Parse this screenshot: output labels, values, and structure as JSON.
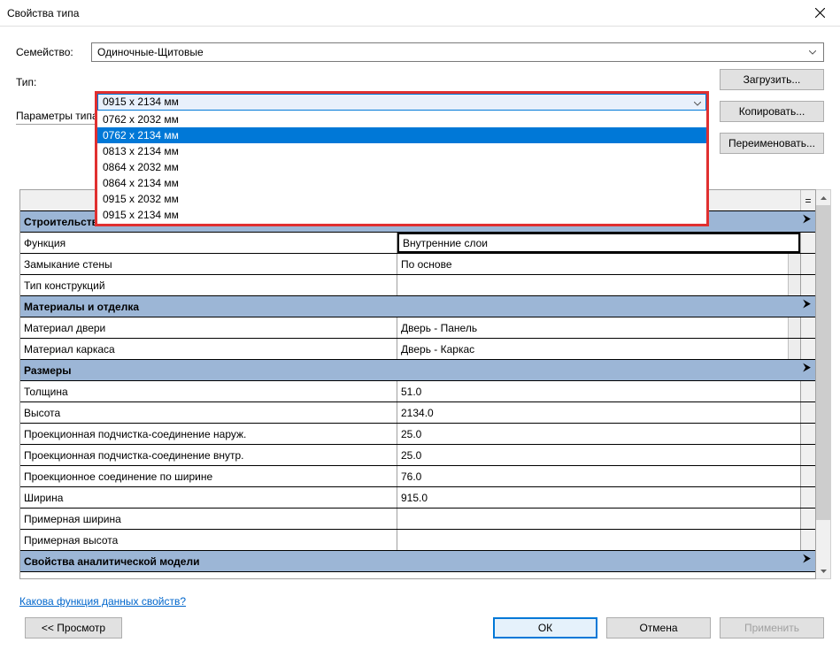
{
  "window": {
    "title": "Свойства типа"
  },
  "labels": {
    "family": "Семейство:",
    "type": "Тип:",
    "params": "Параметры типа"
  },
  "family_select": {
    "value": "Одиночные-Щитовые"
  },
  "type_select": {
    "value": "0915 x 2134 мм"
  },
  "side_buttons": {
    "load": "Загрузить...",
    "copy": "Копировать...",
    "rename": "Переименовать..."
  },
  "dropdown": {
    "items": [
      "0762 x 2032 мм",
      "0762 x 2134 мм",
      "0813 x 2134 мм",
      "0864 x 2032 мм",
      "0864 x 2134 мм",
      "0915 x 2032 мм",
      "0915 x 2134 мм"
    ],
    "highlighted_index": 1
  },
  "eq_header": "=",
  "groups": [
    {
      "name": "Строительство",
      "rows": [
        {
          "label": "Функция",
          "value": "Внутренние слои",
          "bordered": true
        },
        {
          "label": "Замыкание стены",
          "value": "По основе",
          "mini": true
        },
        {
          "label": "Тип конструкций",
          "value": "",
          "mini": true
        }
      ]
    },
    {
      "name": "Материалы и отделка",
      "rows": [
        {
          "label": "Материал двери",
          "value": "Дверь - Панель",
          "mini": true
        },
        {
          "label": "Материал каркаса",
          "value": "Дверь - Каркас",
          "mini": true
        }
      ]
    },
    {
      "name": "Размеры",
      "rows": [
        {
          "label": "Толщина",
          "value": "51.0"
        },
        {
          "label": "Высота",
          "value": "2134.0"
        },
        {
          "label": "Проекционная подчистка-соединение наруж.",
          "value": "25.0"
        },
        {
          "label": "Проекционная подчистка-соединение внутр.",
          "value": "25.0"
        },
        {
          "label": "Проекционное соединение по ширине",
          "value": "76.0"
        },
        {
          "label": "Ширина",
          "value": "915.0"
        },
        {
          "label": "Примерная ширина",
          "value": ""
        },
        {
          "label": "Примерная высота",
          "value": ""
        }
      ]
    },
    {
      "name": "Свойства аналитической модели",
      "rows": []
    }
  ],
  "link": "Какова функция данных свойств?",
  "footer": {
    "preview": "<<  Просмотр",
    "ok": "ОК",
    "cancel": "Отмена",
    "apply": "Применить"
  },
  "collapse_glyph": "«"
}
